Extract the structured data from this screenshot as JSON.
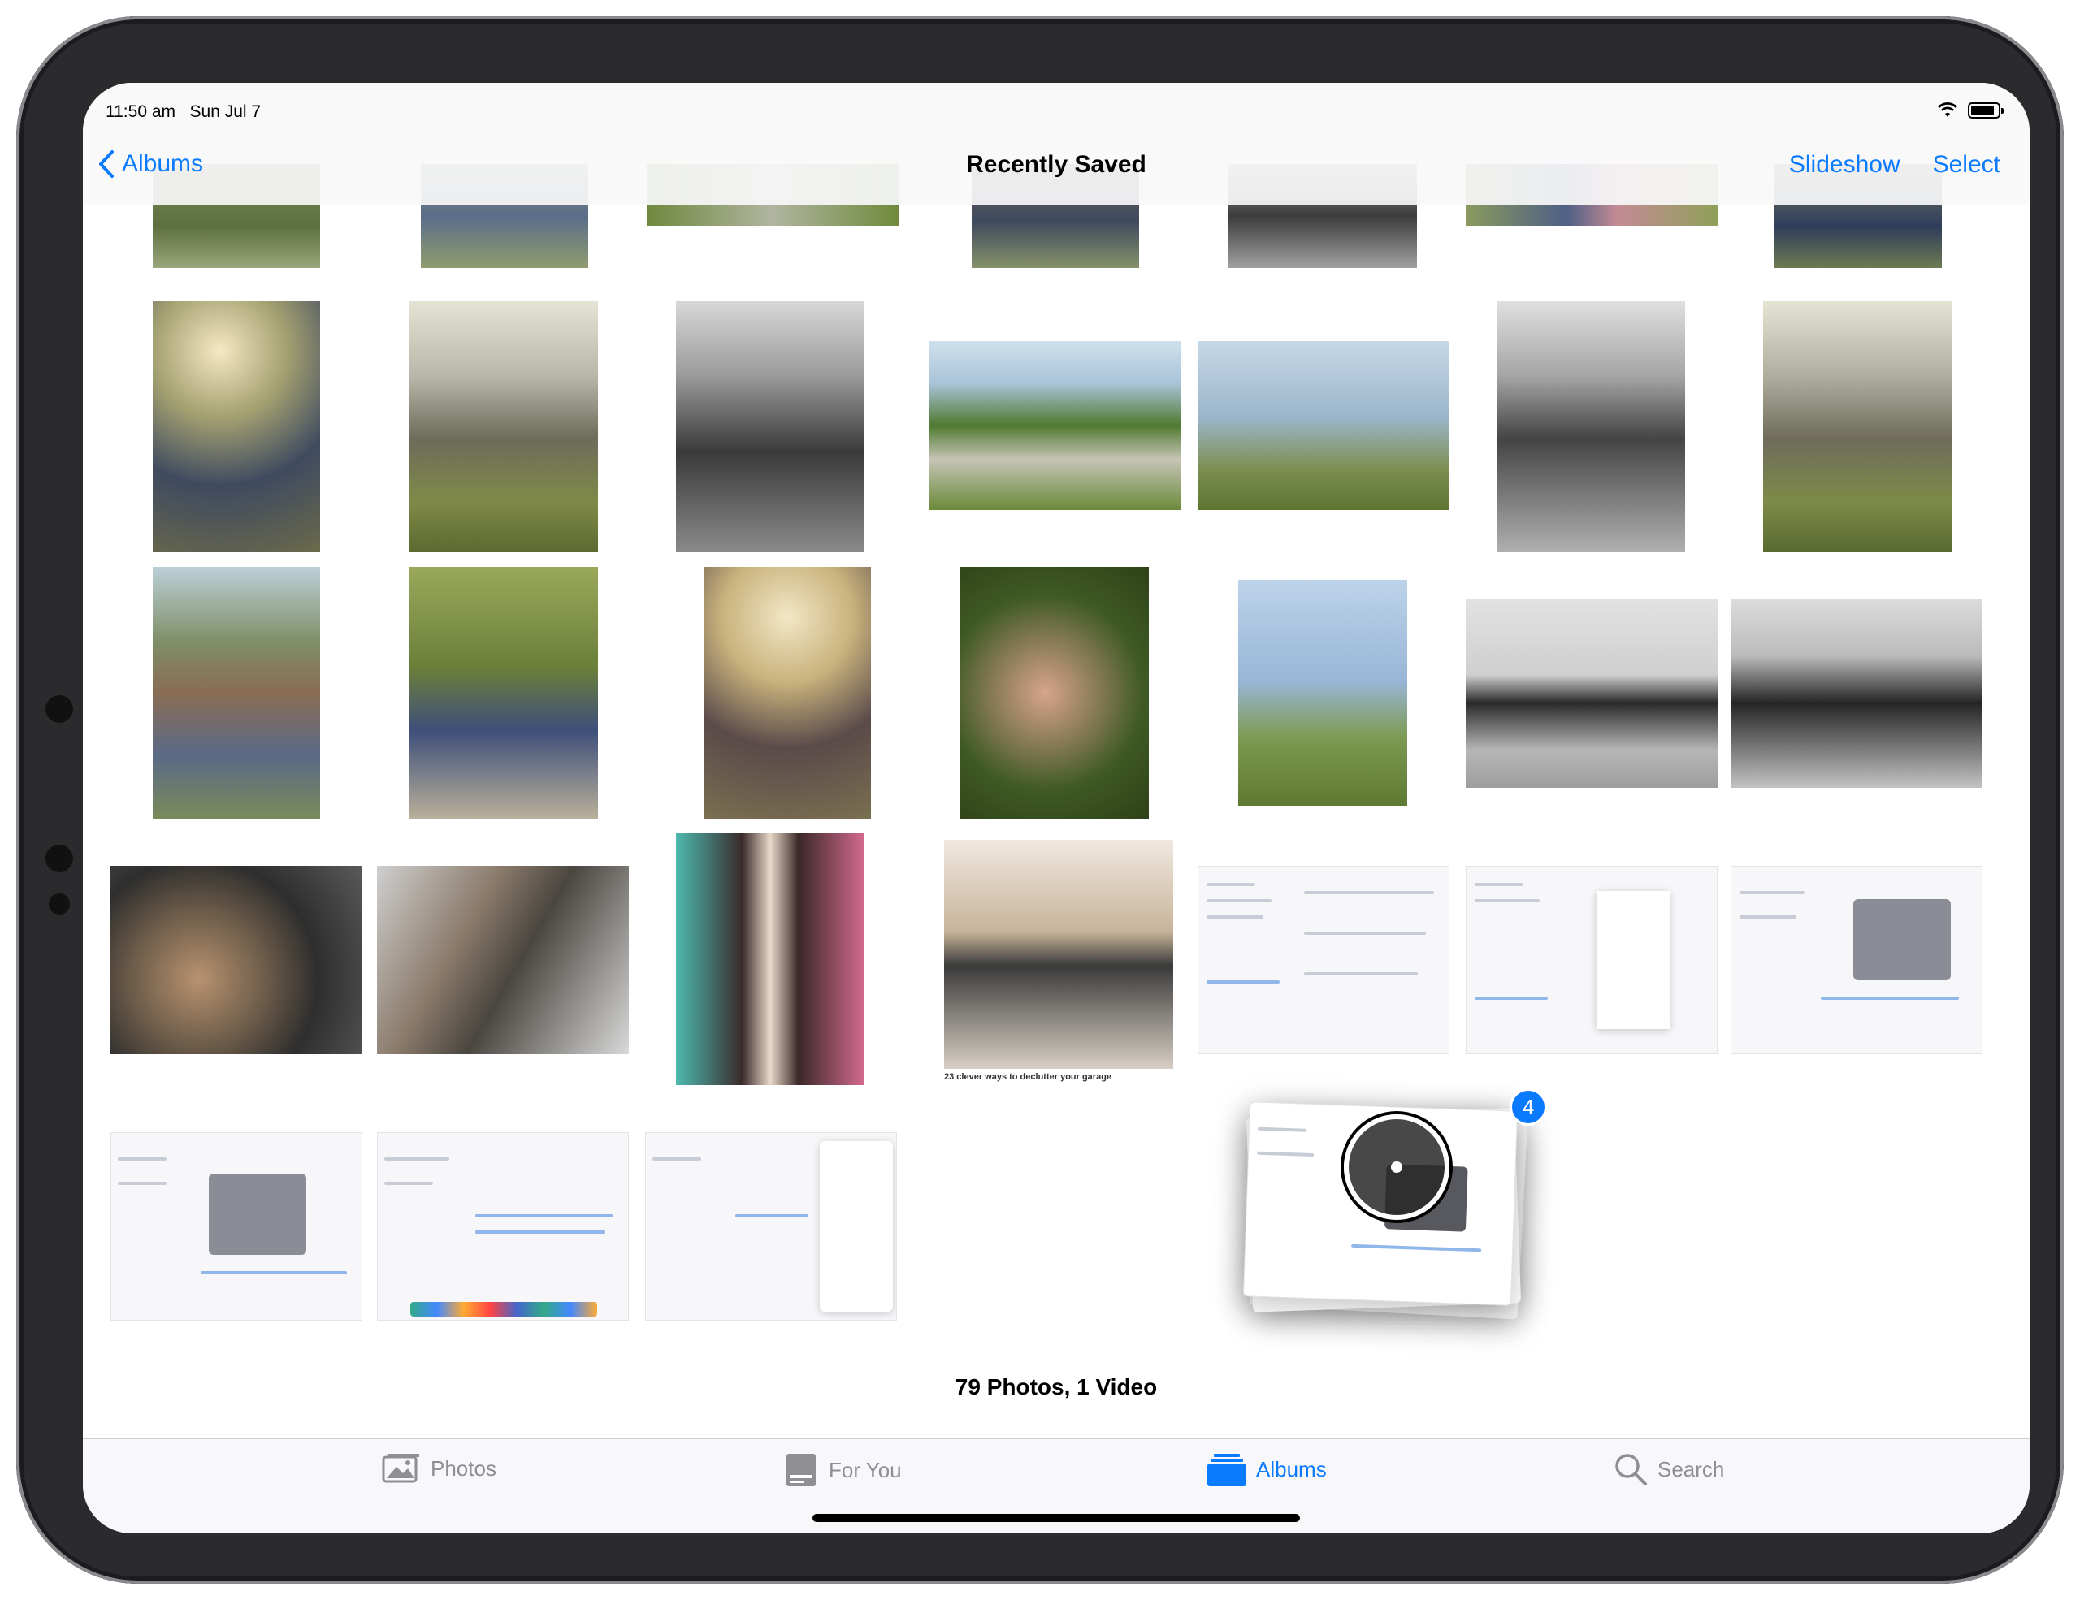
{
  "status": {
    "time": "11:50 am",
    "date": "Sun Jul 7"
  },
  "nav": {
    "back": "Albums",
    "title": "Recently Saved",
    "slideshow": "Slideshow",
    "select": "Select"
  },
  "summary": "79 Photos, 1 Video",
  "caption": "23 clever ways to declutter your garage",
  "drag": {
    "count": "4"
  },
  "tabs": [
    {
      "label": "Photos",
      "icon": "photos-icon"
    },
    {
      "label": "For You",
      "icon": "for-you-icon"
    },
    {
      "label": "Albums",
      "icon": "albums-icon"
    },
    {
      "label": "Search",
      "icon": "search-icon"
    }
  ],
  "colors": {
    "accent": "#0a7aff"
  }
}
